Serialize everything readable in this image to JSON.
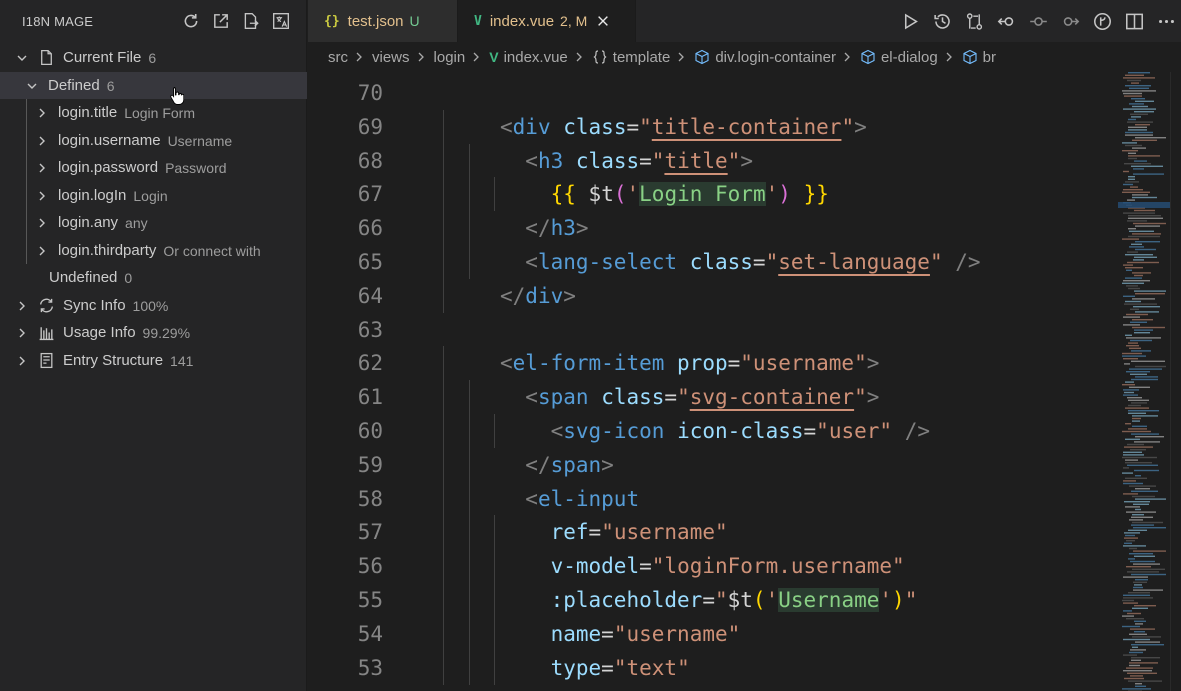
{
  "sidebar": {
    "title": "I18N MAGE",
    "actions": [
      "refresh-icon",
      "open-external-icon",
      "export-file-icon",
      "translate-icon"
    ],
    "current_file": {
      "label": "Current File",
      "count": "6"
    },
    "defined": {
      "label": "Defined",
      "count": "6"
    },
    "entries": [
      {
        "key": "login.title",
        "value": "Login Form"
      },
      {
        "key": "login.username",
        "value": "Username"
      },
      {
        "key": "login.password",
        "value": "Password"
      },
      {
        "key": "login.logIn",
        "value": "Login"
      },
      {
        "key": "login.any",
        "value": "any"
      },
      {
        "key": "login.thirdparty",
        "value": "Or connect with"
      }
    ],
    "undefined": {
      "label": "Undefined",
      "count": "0"
    },
    "sync_info": {
      "label": "Sync Info",
      "value": "100%"
    },
    "usage_info": {
      "label": "Usage Info",
      "value": "99.29%"
    },
    "entry_structure": {
      "label": "Entry Structure",
      "value": "141"
    }
  },
  "tabs": [
    {
      "name": "test.json",
      "status": "U",
      "icon": "{}",
      "active": false
    },
    {
      "name": "index.vue",
      "status": "2, M",
      "icon": "V",
      "active": true
    }
  ],
  "editor_actions": [
    "run-icon",
    "timeline-icon",
    "compare-changes-icon",
    "go-back-icon",
    "commit-icon",
    "go-forward-icon",
    "git-graph-icon",
    "split-editor-icon",
    "more-icon"
  ],
  "breadcrumb": {
    "items": [
      "src",
      "views",
      "login",
      "index.vue",
      "template",
      "div.login-container",
      "el-dialog",
      "br"
    ]
  },
  "code": {
    "line_numbers": [
      "70",
      "69",
      "68",
      "67",
      "66",
      "65",
      "64",
      "63",
      "62",
      "61",
      "60",
      "59",
      "58",
      "57",
      "56",
      "55",
      "54",
      "53"
    ],
    "lines": [
      "",
      "<div class=\"title-container\">",
      "<h3 class=\"title\">",
      "{{ $t('Login Form') }}",
      "</h3>",
      "<lang-select class=\"set-language\" />",
      "</div>",
      "",
      "<el-form-item prop=\"username\">",
      "<span class=\"svg-container\">",
      "<svg-icon icon-class=\"user\" />",
      "</span>",
      "<el-input",
      "ref=\"username\"",
      "v-model=\"loginForm.username\"",
      ":placeholder=\"$t('Username')\"",
      "name=\"username\"",
      "type=\"text\""
    ]
  },
  "colors": {
    "tag": "#569cd6",
    "attribute": "#9cdcfe",
    "string": "#ce9178",
    "active_tab_text": "#e2c08d"
  }
}
